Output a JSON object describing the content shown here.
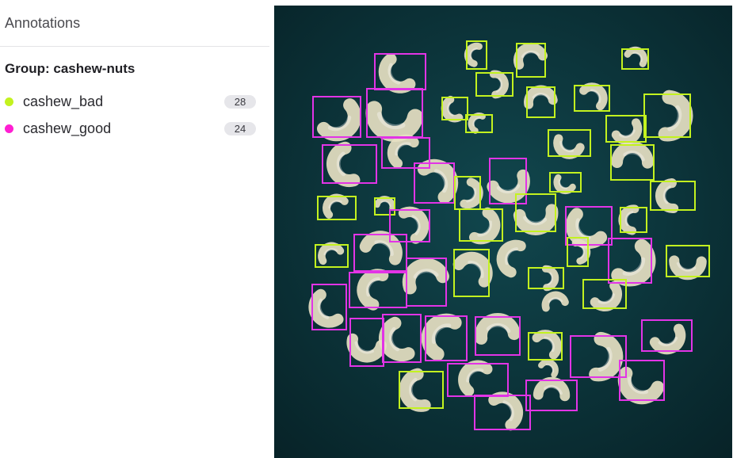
{
  "panel": {
    "title": "Annotations"
  },
  "group": {
    "title": "Group: cashew-nuts",
    "labels": [
      {
        "name": "cashew_bad",
        "count": "28",
        "color": "#c3f21f"
      },
      {
        "name": "cashew_good",
        "count": "24",
        "color": "#ff1fd2"
      }
    ]
  },
  "colors": {
    "image_background": "#0d3a40",
    "cashew": "#e6e0c2",
    "bad_box": "#c3f21f",
    "good_box": "#e234e6"
  }
}
